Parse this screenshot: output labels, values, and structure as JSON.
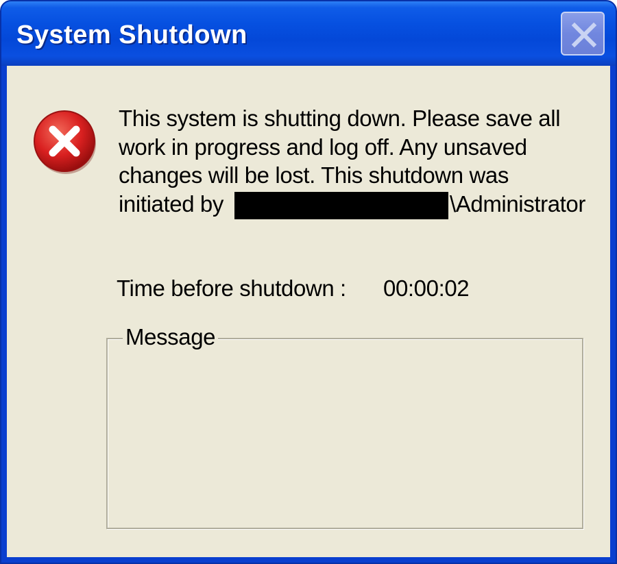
{
  "window": {
    "title": "System Shutdown",
    "close_icon": "close-icon"
  },
  "dialog": {
    "icon": "error-icon",
    "message_lines": [
      "This system is shutting down. Please save all",
      "work in progress and log off. Any unsaved",
      "changes will be lost. This shutdown was",
      "initiated by"
    ],
    "initiator_suffix": "\\Administrator",
    "time_label": "Time before shutdown :",
    "time_value": "00:00:02",
    "message_group_label": "Message",
    "message_text": ""
  },
  "colors": {
    "titlebar": "#0650e0",
    "client_background": "#ece9d8",
    "error_icon": "#d92020"
  }
}
